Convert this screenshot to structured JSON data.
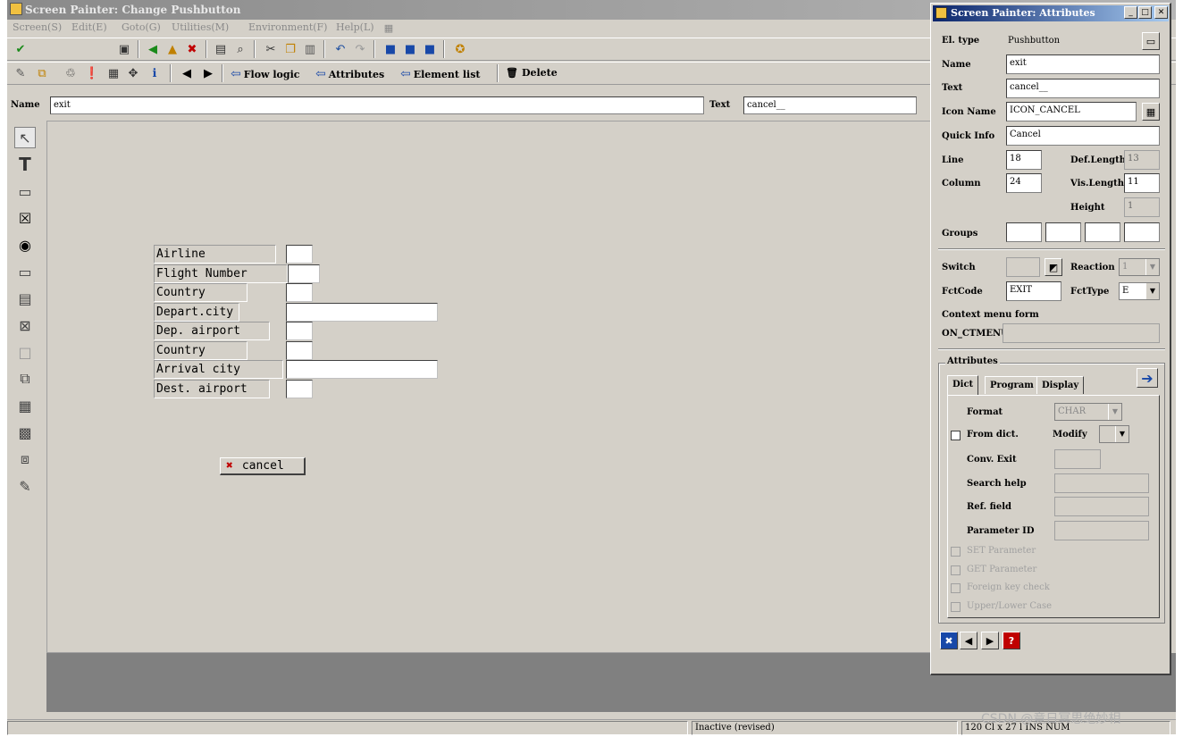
{
  "window": {
    "title": "Screen Painter:  Change Pushbutton"
  },
  "menu": [
    "Screen(S)",
    "Edit(E)",
    "Goto(G)",
    "Utilities(M)",
    "Environment(F)",
    "Help(L)"
  ],
  "toolbar2": {
    "flow_logic": "Flow logic",
    "attributes": "Attributes",
    "element_list": "Element list",
    "delete": "Delete"
  },
  "namebar": {
    "name_label": "Name",
    "name_value": "exit",
    "text_label": "Text",
    "text_value": "cancel__"
  },
  "screen_fields": [
    {
      "label": "Airline"
    },
    {
      "label": "Flight Number"
    },
    {
      "label": "Country"
    },
    {
      "label": "Depart.city"
    },
    {
      "label": "Dep. airport"
    },
    {
      "label": "Country"
    },
    {
      "label": "Arrival city"
    },
    {
      "label": "Dest. airport"
    }
  ],
  "pushbutton": {
    "label": "cancel",
    "icon": "cancel-x-icon"
  },
  "status": {
    "state": "Inactive (revised)",
    "position": "120 Cl x 27 l  INS  NUM"
  },
  "watermark": "CSDN @竟日冥思绝妙相",
  "attr_dialog": {
    "title": "Screen Painter: Attributes",
    "el_type_label": "El. type",
    "el_type_value": "Pushbutton",
    "name_label": "Name",
    "name_value": "exit",
    "text_label": "Text",
    "text_value": "cancel__",
    "icon_name_label": "Icon Name",
    "icon_name_value": "ICON_CANCEL",
    "quick_info_label": "Quick Info",
    "quick_info_value": "Cancel",
    "line_label": "Line",
    "line_value": "18",
    "column_label": "Column",
    "column_value": "24",
    "def_length_label": "Def.Length",
    "def_length_value": "13",
    "vis_length_label": "Vis.Length",
    "vis_length_value": "11",
    "height_label": "Height",
    "height_value": "1",
    "groups_label": "Groups",
    "switch_label": "Switch",
    "reaction_label": "Reaction",
    "reaction_value": "1",
    "fctcode_label": "FctCode",
    "fctcode_value": "EXIT",
    "fcttype_label": "FctType",
    "fcttype_value": "E",
    "context_menu_label": "Context menu form",
    "on_ctmenu_label": "ON_CTMENU_",
    "attributes_group": "Attributes",
    "tabs": [
      "Dict",
      "Program",
      "Display"
    ],
    "format_label": "Format",
    "format_value": "CHAR",
    "from_dict_label": "From dict.",
    "modify_label": "Modify",
    "conv_exit_label": "Conv. Exit",
    "search_help_label": "Search help",
    "ref_field_label": "Ref. field",
    "parameter_id_label": "Parameter ID",
    "set_param_label": "SET Parameter",
    "get_param_label": "GET Parameter",
    "foreign_key_label": "Foreign key check",
    "upper_lower_label": "Upper/Lower Case"
  }
}
